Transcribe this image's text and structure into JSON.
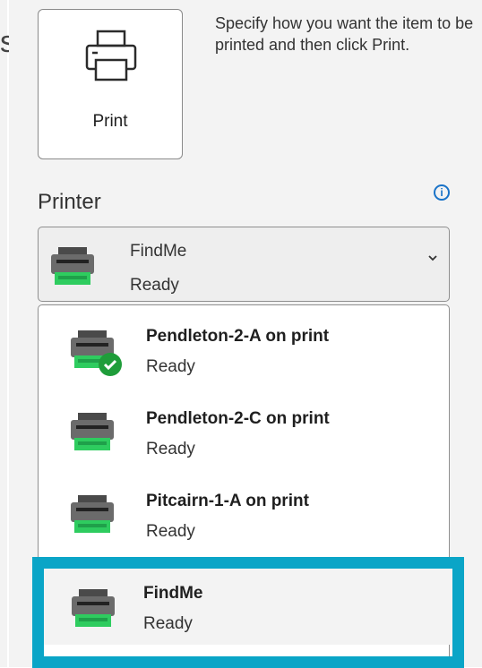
{
  "left_fragment": "s",
  "print_button": {
    "label": "Print"
  },
  "description": "Specify how you want the item to be printed and then click Print.",
  "printer_section": {
    "title": "Printer",
    "info": "i"
  },
  "selected_printer": {
    "name": "FindMe",
    "status": "Ready"
  },
  "dropdown": {
    "items": [
      {
        "name": "Pendleton-2-A on print",
        "status": "Ready",
        "default": true
      },
      {
        "name": "Pendleton-2-C on print",
        "status": "Ready",
        "default": false
      },
      {
        "name": "Pitcairn-1-A on print",
        "status": "Ready",
        "default": false
      },
      {
        "name": "FindMe",
        "status": "Ready",
        "default": false
      }
    ]
  },
  "colors": {
    "highlight": "#0aa5c7",
    "printer_body": "#6b6b6b",
    "printer_tray": "#2ecc5f",
    "check": "#1f9d3a",
    "info": "#1a73c8"
  },
  "icons": [
    "printer-outline-icon",
    "printer-color-icon",
    "default-check-icon",
    "info-icon",
    "chevron-down-icon"
  ]
}
